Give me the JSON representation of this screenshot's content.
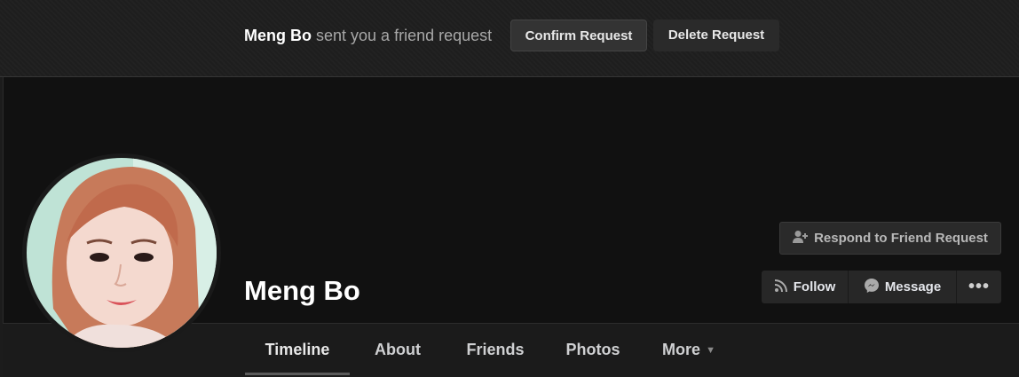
{
  "request_bar": {
    "sender_name": "Meng Bo",
    "message": "sent you a friend request",
    "confirm_label": "Confirm Request",
    "delete_label": "Delete Request"
  },
  "profile": {
    "name": "Meng Bo",
    "respond_label": "Respond to Friend Request",
    "follow_label": "Follow",
    "message_label": "Message",
    "more_actions": "•••"
  },
  "tabs": [
    {
      "label": "Timeline",
      "active": true
    },
    {
      "label": "About"
    },
    {
      "label": "Friends"
    },
    {
      "label": "Photos"
    },
    {
      "label": "More"
    }
  ],
  "icons": {
    "respond": "add-friend-icon",
    "follow": "rss-feed-icon",
    "message": "messenger-icon",
    "more_tab": "caret-down-icon"
  },
  "colors": {
    "background": "#111111",
    "bar": "#1e1e1e",
    "button": "#333333",
    "text_primary": "#ffffff",
    "text_muted": "#a8a8a8"
  }
}
